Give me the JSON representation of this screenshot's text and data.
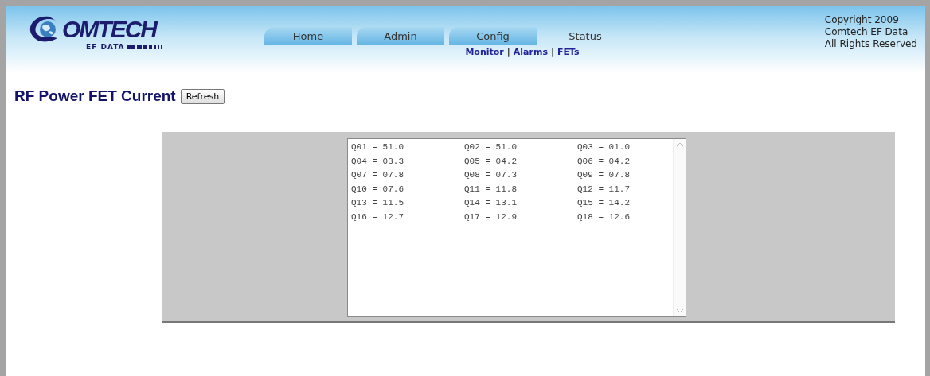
{
  "logo": {
    "wordmark": "OMTECH",
    "subtitle": "EF DATA"
  },
  "tabs": [
    {
      "label": "Home",
      "selected": false
    },
    {
      "label": "Admin",
      "selected": false
    },
    {
      "label": "Config",
      "selected": false
    },
    {
      "label": "Status",
      "selected": true
    }
  ],
  "subnav": [
    {
      "label": "Monitor",
      "separator": "|"
    },
    {
      "label": "Alarms",
      "separator": "|"
    },
    {
      "label": "FETs"
    }
  ],
  "copyright": [
    "Copyright 2009",
    "Comtech EF Data",
    "All Rights Reserved"
  ],
  "page_title": "RF Power FET Current",
  "refresh_button": "Refresh",
  "readings": [
    "Q01 = 51.0",
    "Q02 = 51.0",
    "Q03 = 01.0",
    "Q04 = 03.3",
    "Q05 = 04.2",
    "Q06 = 04.2",
    "Q07 = 07.8",
    "Q08 = 07.3",
    "Q09 = 07.8",
    "Q10 = 07.6",
    "Q11 = 11.8",
    "Q12 = 11.7",
    "Q13 = 11.5",
    "Q14 = 13.1",
    "Q15 = 14.2",
    "Q16 = 12.7",
    "Q17 = 12.9",
    "Q18 = 12.6"
  ]
}
